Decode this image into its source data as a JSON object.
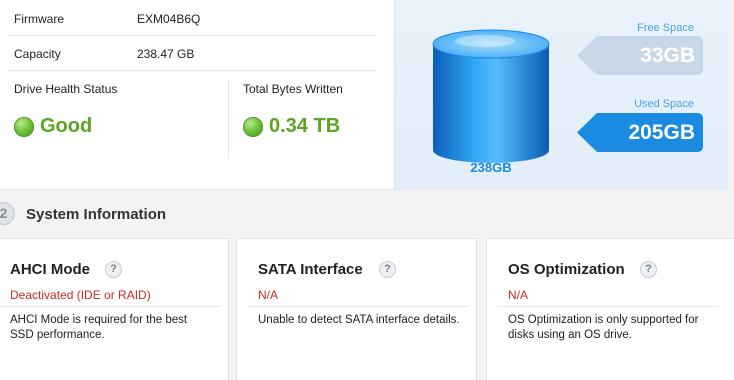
{
  "drive_info": {
    "firmware": {
      "label": "Firmware",
      "value": "EXM04B6Q"
    },
    "capacity": {
      "label": "Capacity",
      "value": "238.47 GB"
    },
    "health": {
      "label": "Drive Health Status",
      "value": "Good"
    },
    "tbw": {
      "label": "Total Bytes Written",
      "value": "0.34 TB"
    }
  },
  "disk_space": {
    "total": "238GB",
    "free_label": "Free Space",
    "free_value": "33GB",
    "used_label": "Used Space",
    "used_value": "205GB",
    "colors": {
      "free_arrow": "#c9d8e8",
      "used_arrow": "#1a8be0",
      "cylinder": "#1a8be0"
    }
  },
  "system_info": {
    "number": "2",
    "title": "System Information",
    "cards": [
      {
        "title": "AHCI Mode",
        "help": "?",
        "status": "Deactivated (IDE or RAID)",
        "desc": "AHCI Mode is required for the best SSD performance."
      },
      {
        "title": "SATA Interface",
        "help": "?",
        "status": "N/A",
        "desc": "Unable to detect SATA interface details."
      },
      {
        "title": "OS Optimization",
        "help": "?",
        "status": "N/A",
        "desc": "OS Optimization is only supported for disks using an OS drive."
      }
    ]
  },
  "colors": {
    "good": "#5aa524",
    "error": "#cc2a1e",
    "accent": "#1a8be0"
  }
}
